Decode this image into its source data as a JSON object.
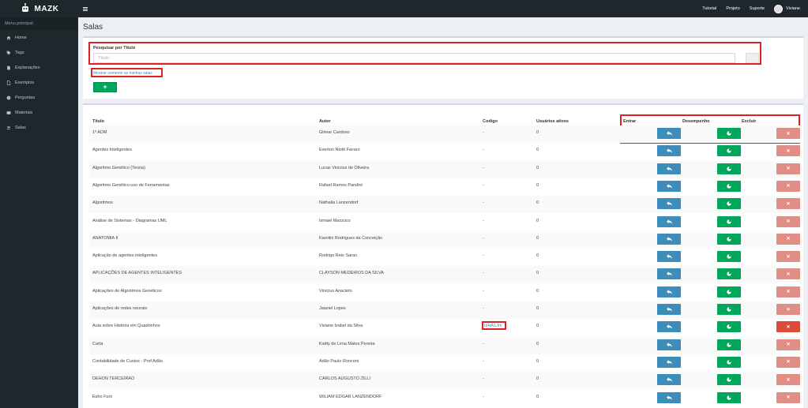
{
  "app": {
    "brand": "MAZK"
  },
  "topnav": {
    "tutorial": "Tutorial",
    "project": "Projeto",
    "support": "Suporte",
    "user": "Viviane"
  },
  "sidebar": {
    "title": "Menu principal",
    "items": [
      {
        "label": "Home",
        "icon": "home-icon"
      },
      {
        "label": "Tags",
        "icon": "tag-icon"
      },
      {
        "label": "Explanações",
        "icon": "file-icon"
      },
      {
        "label": "Exemplos",
        "icon": "document-icon"
      },
      {
        "label": "Perguntas",
        "icon": "question-icon"
      },
      {
        "label": "Materiais",
        "icon": "book-icon"
      },
      {
        "label": "Salas",
        "icon": "users-icon"
      }
    ]
  },
  "page": {
    "title": "Salas"
  },
  "search": {
    "label": "Pesquisar por Título",
    "placeholder": "Título",
    "mine_link": "Mostrar somente as minhas salas",
    "add_label": "+"
  },
  "table": {
    "headers": {
      "title": "Título",
      "author": "Autor",
      "code": "Codigo",
      "active": "Usuários ativos",
      "enter": "Entrar",
      "performance": "Desempenho",
      "delete": "Excluir"
    },
    "rows": [
      {
        "title": "1º ADM",
        "author": "Gilmar Cardoso",
        "code": "-",
        "active": "0"
      },
      {
        "title": "Agentes Inteligentes",
        "author": "Everton Niotti Favaro",
        "code": "-",
        "active": "0"
      },
      {
        "title": "Algoritmo Genético (Teoria)",
        "author": "Lucas Vinícius de Oliveira",
        "code": "-",
        "active": "0"
      },
      {
        "title": "Algoritmo Genético uso de Ferramentas",
        "author": "Rafael Ramos Pandini",
        "code": "-",
        "active": "0"
      },
      {
        "title": "Algoritmos",
        "author": "Nathalia Lanzendorf",
        "code": "-",
        "active": "0"
      },
      {
        "title": "Análise de Sistemas - Diagramas UML",
        "author": "Ismael Mazzuco",
        "code": "-",
        "active": "0"
      },
      {
        "title": "ANATOMIA II",
        "author": "Karolini Rodrigues da Conceição",
        "code": "-",
        "active": "0"
      },
      {
        "title": "Aplicação de agentes inteligentes",
        "author": "Rodrigo Reis Saran",
        "code": "-",
        "active": "0"
      },
      {
        "title": "APLICAÇÕES DE AGENTES INTELIGENTES",
        "author": "CLAYSON MEDEIROS DA SILVA",
        "code": "-",
        "active": "0"
      },
      {
        "title": "Aplicações de Algoritmos Genéticos",
        "author": "Vinícius Anacleto",
        "code": "-",
        "active": "0"
      },
      {
        "title": "Aplicações de redes neurais",
        "author": "Jaaziel Lopes",
        "code": "-",
        "active": "0"
      },
      {
        "title": "Aula sobre História em Quadrinhos",
        "author": "Viviane Izabel da Silva",
        "code": "IpHA1Jm",
        "active": "0"
      },
      {
        "title": "Carta",
        "author": "Kaitty de Lima Matos Pereira",
        "code": "-",
        "active": "0"
      },
      {
        "title": "Contabilidade de Custos - Prof Adão",
        "author": "Adão Paulo Ronconi",
        "code": "-",
        "active": "0"
      },
      {
        "title": "DEHON TERCEIRAO",
        "author": "CARLOS AUGUSTO ZILLI",
        "code": "-",
        "active": "0"
      },
      {
        "title": "Esho Funi",
        "author": "WILIAM EDGAR LANZENDORF",
        "code": "-",
        "active": "0"
      }
    ]
  }
}
